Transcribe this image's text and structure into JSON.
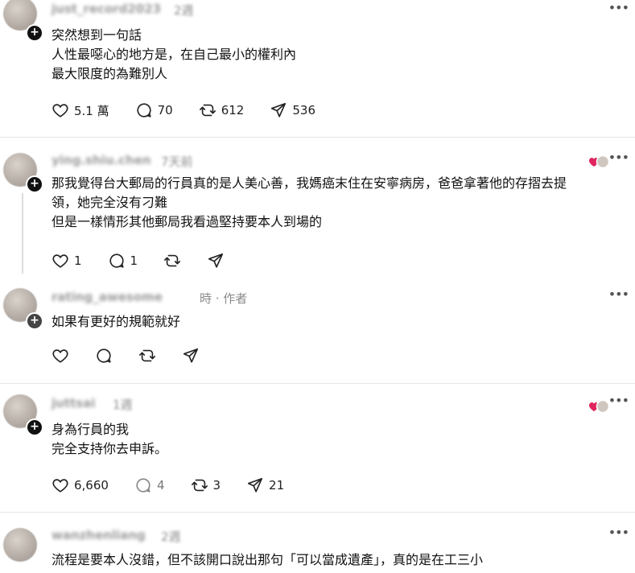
{
  "posts": [
    {
      "username": "just_record2023",
      "meta": "2週",
      "lines": [
        "突然想到一句話",
        "人性最噁心的地方是，在自己最小的權利內",
        "最大限度的為難別人"
      ],
      "likes": "5.1 萬",
      "replies": "70",
      "reposts": "612",
      "shares": "536"
    },
    {
      "username": "ying.shiu.chen",
      "meta": "7天前",
      "lines": [
        "那我覺得台大郵局的行員真的是人美心善，我媽癌末住在安寧病房，爸爸拿著他的存摺去提",
        "領，她完全沒有刁難",
        "但是一樣情形其他郵局我看過堅持要本人到場的"
      ],
      "likes": "1",
      "replies": "1",
      "reposts": "",
      "shares": ""
    },
    {
      "username": "rating_awesome",
      "meta": "時 · 作者",
      "lines": [
        "如果有更好的規範就好"
      ],
      "likes": "",
      "replies": "",
      "reposts": "",
      "shares": ""
    },
    {
      "username": "juttsai",
      "meta": "1週",
      "lines": [
        "身為行員的我",
        "完全支持你去申訴。"
      ],
      "likes": "6,660",
      "replies": "4",
      "reposts": "3",
      "shares": "21"
    },
    {
      "username": "wanzhenliang",
      "meta": "2週",
      "lines": [
        "流程是要本人沒錯，但不該開口說出那句「可以當成遺產」，真的是在工三小"
      ],
      "likes": "",
      "replies": "",
      "reposts": "",
      "shares": ""
    }
  ],
  "icons": {
    "like": "heart-outline-icon",
    "reply": "comment-bubble-icon",
    "repost": "repost-arrows-icon",
    "share": "send-paper-plane-icon",
    "more": "more-dots-icon",
    "follow": "plus-badge-icon",
    "reaction": "heart-reaction-icon"
  },
  "colors": {
    "reaction_heart": "#e0245e",
    "text": "#101010",
    "muted": "#8a8a8a"
  }
}
